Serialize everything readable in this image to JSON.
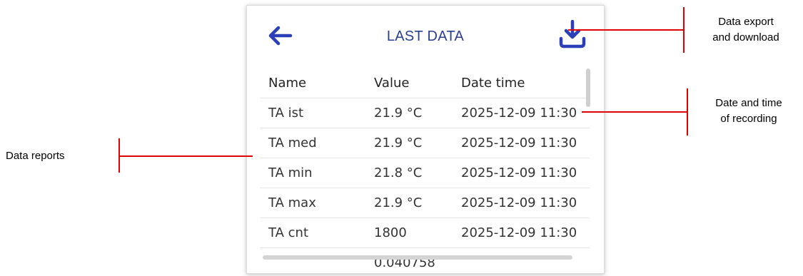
{
  "header": {
    "title": "LAST DATA",
    "back_icon": "arrow-left-icon",
    "download_icon": "download-icon",
    "accent_color": "#2a3f8f"
  },
  "table": {
    "columns": [
      "Name",
      "Value",
      "Date time"
    ],
    "rows": [
      {
        "name": "TA ist",
        "value": "21.9 °C",
        "date": "2025-12-09 11:30"
      },
      {
        "name": "TA med",
        "value": "21.9 °C",
        "date": "2025-12-09 11:30"
      },
      {
        "name": "TA min",
        "value": "21.8 °C",
        "date": "2025-12-09 11:30"
      },
      {
        "name": "TA max",
        "value": "21.9 °C",
        "date": "2025-12-09 11:30"
      },
      {
        "name": "TA cnt",
        "value": "1800",
        "date": "2025-12-09 11:30"
      },
      {
        "name": "",
        "value": "0.040758",
        "date": ""
      }
    ]
  },
  "annotations": {
    "export_line1": "Data export",
    "export_line2": "and download",
    "datetime_line1": "Date and time",
    "datetime_line2": "of recording",
    "reports": "Data reports",
    "line_color": "#e00000"
  }
}
